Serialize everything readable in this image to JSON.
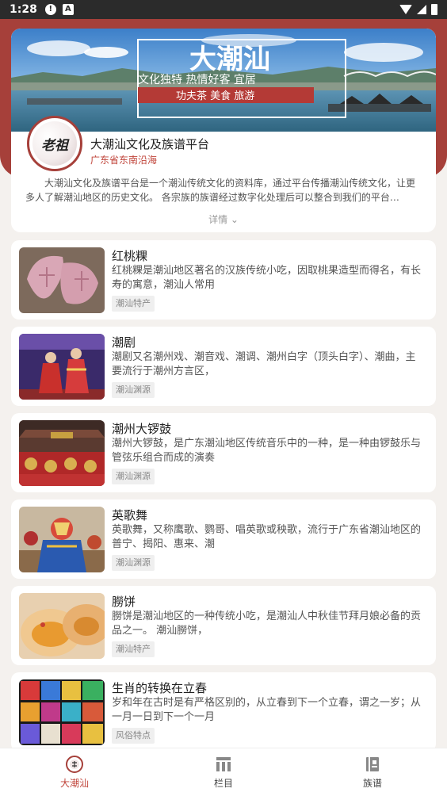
{
  "status_bar": {
    "time": "1:28"
  },
  "header": {
    "banner": {
      "title": "大潮汕",
      "slogan": "文化独特 热情好客 宜居",
      "tags": "功夫茶 美食 旅游"
    },
    "logo_text": "老祖",
    "app_title": "大潮汕文化及族谱平台",
    "app_subtitle": "广东省东南沿海",
    "description": "大潮汕文化及族谱平台是一个潮汕传统文化的资料库，通过平台传播潮汕传统文化，让更多人了解潮汕地区的历史文化。 各宗族的族谱经过数字化处理后可以整合到我们的平台…",
    "details_label": "详情 ⌄"
  },
  "items": [
    {
      "title": "红桃粿",
      "desc": "红桃粿是潮汕地区著名的汉族传统小吃，因取桃果造型而得名，有长寿的寓意，潮汕人常用",
      "tag": "潮汕特产"
    },
    {
      "title": "潮剧",
      "desc": "潮剧又名潮州戏、潮音戏、潮调、潮州白字（顶头白字）、潮曲，主要流行于潮州方言区，",
      "tag": "潮汕渊源"
    },
    {
      "title": "潮州大锣鼓",
      "desc": "潮州大锣鼓，是广东潮汕地区传统音乐中的一种，是一种由锣鼓乐与管弦乐组合而成的演奏",
      "tag": "潮汕渊源"
    },
    {
      "title": "英歌舞",
      "desc": "英歌舞，又称鹰歌、鹦哥、唱英歌或秧歌，流行于广东省潮汕地区的普宁、揭阳、惠来、潮",
      "tag": "潮汕渊源"
    },
    {
      "title": "朥饼",
      "desc": "朥饼是潮汕地区的一种传统小吃，是潮汕人中秋佳节拜月娘必备的贡品之一。 潮汕朥饼，",
      "tag": "潮汕特产"
    },
    {
      "title": "生肖的转换在立春",
      "desc": "岁和年在古时是有严格区别的，从立春到下一个立春，谓之一岁；从一月一日到下一个一月",
      "tag": "风俗特点"
    }
  ],
  "bottom_nav": [
    {
      "label": "大潮汕",
      "icon": "home-logo-icon",
      "active": true
    },
    {
      "label": "栏目",
      "icon": "columns-icon",
      "active": false
    },
    {
      "label": "族谱",
      "icon": "genealogy-book-icon",
      "active": false
    }
  ],
  "colors": {
    "brand_red": "#a6403a",
    "active_nav": "#c0443a",
    "subtitle": "#c0443a"
  }
}
